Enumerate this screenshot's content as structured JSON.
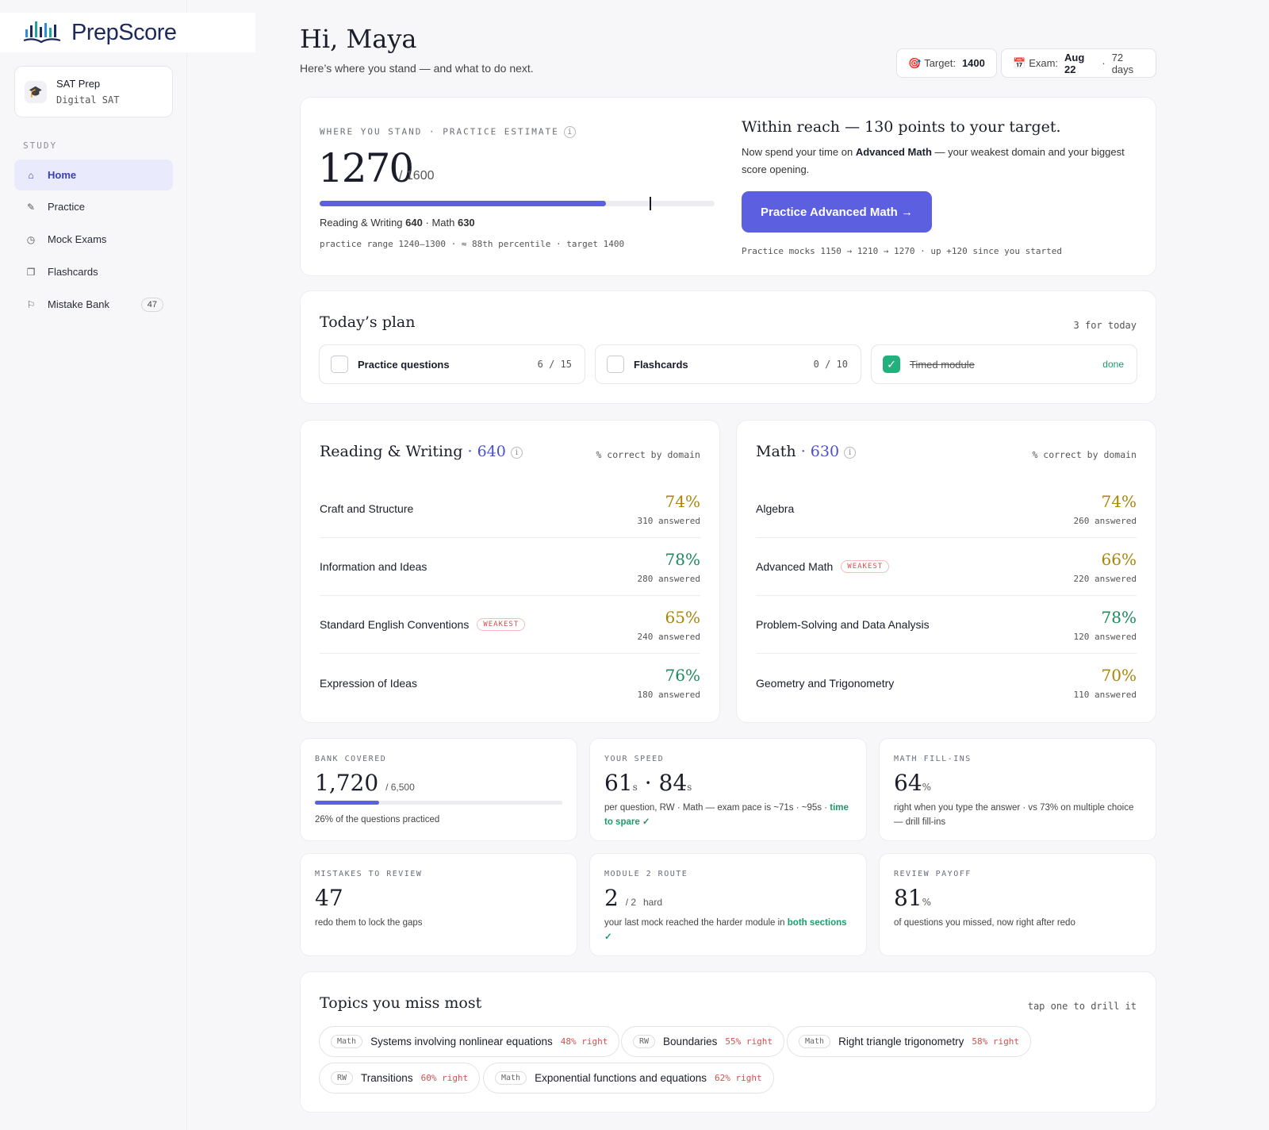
{
  "brand": {
    "name": "PrepScore"
  },
  "course": {
    "title": "SAT Prep",
    "subtitle": "Digital SAT"
  },
  "sidebar": {
    "section": "STUDY",
    "items": [
      {
        "label": "Home",
        "icon": "home-icon"
      },
      {
        "label": "Practice",
        "icon": "pencil-icon"
      },
      {
        "label": "Mock Exams",
        "icon": "stopwatch-icon"
      },
      {
        "label": "Flashcards",
        "icon": "cards-icon"
      },
      {
        "label": "Mistake Bank",
        "icon": "flag-icon",
        "badge": "47"
      }
    ]
  },
  "header": {
    "greeting": "Hi, Maya",
    "subtitle": "Here’s where you stand — and what to do next.",
    "target_label": "Target:",
    "target_value": "1400",
    "exam_label": "Exam:",
    "exam_date": "Aug 22",
    "exam_sep": "·",
    "exam_days": "72 days"
  },
  "score": {
    "label": "WHERE YOU STAND · PRACTICE ESTIMATE",
    "value": "1270",
    "max": "/ 1600",
    "progress": 0.725,
    "target_marker": 0.836,
    "rw_label": "Reading & Writing",
    "rw_value": "640",
    "math_label": "· Math",
    "math_value": "630",
    "range_text": "practice range 1240–1300 · ≈ 88th percentile · target 1400"
  },
  "reach": {
    "title": "Within reach — 130 points to your target.",
    "desc_pre": "Now spend your time on",
    "desc_bold": "Advanced Math",
    "desc_post": "— your weakest domain and your biggest score opening.",
    "button": "Practice Advanced Math →",
    "mocks": "Practice mocks 1150 → 1210 → 1270 · up +120 since you started"
  },
  "plan": {
    "title": "Today’s plan",
    "count": "3 for today",
    "tasks": [
      {
        "label": "Practice questions",
        "progress": "6 / 15",
        "done": false
      },
      {
        "label": "Flashcards",
        "progress": "0 / 10",
        "done": false
      },
      {
        "label": "Timed module",
        "progress": "done",
        "done": true,
        "check": "✓"
      }
    ]
  },
  "rw": {
    "title": "Reading & Writing",
    "score": "· 640",
    "caption": "% correct by domain",
    "domains": [
      {
        "name": "Craft and Structure",
        "pct": "74%",
        "answered": "310 answered",
        "color": "#a8860c"
      },
      {
        "name": "Information and Ideas",
        "pct": "78%",
        "answered": "280 answered",
        "color": "#1d8a5e"
      },
      {
        "name": "Standard English Conventions",
        "pct": "65%",
        "answered": "240 answered",
        "color": "#a8860c",
        "weak": "WEAKEST"
      },
      {
        "name": "Expression of Ideas",
        "pct": "76%",
        "answered": "180 answered",
        "color": "#1d8a5e"
      }
    ]
  },
  "math": {
    "title": "Math",
    "score": "· 630",
    "caption": "% correct by domain",
    "domains": [
      {
        "name": "Algebra",
        "pct": "74%",
        "answered": "260 answered",
        "color": "#a8860c"
      },
      {
        "name": "Advanced Math",
        "pct": "66%",
        "answered": "220 answered",
        "color": "#a8860c",
        "weak": "WEAKEST"
      },
      {
        "name": "Problem-Solving and Data Analysis",
        "pct": "78%",
        "answered": "120 answered",
        "color": "#1d8a5e"
      },
      {
        "name": "Geometry and Trigonometry",
        "pct": "70%",
        "answered": "110 answered",
        "color": "#a8860c"
      }
    ]
  },
  "stats": {
    "bank": {
      "label": "BANK COVERED",
      "value": "1,720",
      "of": "/ 6,500",
      "progress": 0.26,
      "desc": "26% of the questions practiced"
    },
    "speed": {
      "label": "YOUR SPEED",
      "v1": "61",
      "u1": "s",
      "sep": "·",
      "v2": "84",
      "u2": "s",
      "desc": "per question, RW · Math — exam pace is ~71s · ~95s ·",
      "ok": "time to spare ✓"
    },
    "fill": {
      "label": "MATH FILL-INS",
      "value": "64",
      "unit": "%",
      "desc": "right when you type the answer · vs 73% on multiple choice — drill fill-ins"
    },
    "mistakes": {
      "label": "MISTAKES TO REVIEW",
      "value": "47",
      "desc": "redo them to lock the gaps"
    },
    "route": {
      "label": "MODULE 2 ROUTE",
      "value": "2",
      "of": "/ 2",
      "unit": "hard",
      "desc": "your last mock reached the harder module in",
      "ok": "both sections ✓"
    },
    "payoff": {
      "label": "REVIEW PAYOFF",
      "value": "81",
      "unit": "%",
      "desc": "of questions you missed, now right after redo"
    }
  },
  "topics": {
    "title": "Topics you miss most",
    "hint": "tap one to drill it",
    "items": [
      {
        "tag": "Math",
        "name": "Systems involving nonlinear equations",
        "rate": "48% right"
      },
      {
        "tag": "RW",
        "name": "Boundaries",
        "rate": "55% right"
      },
      {
        "tag": "Math",
        "name": "Right triangle trigonometry",
        "rate": "58% right"
      },
      {
        "tag": "RW",
        "name": "Transitions",
        "rate": "60% right"
      },
      {
        "tag": "Math",
        "name": "Exponential functions and equations",
        "rate": "62% right"
      }
    ]
  },
  "colors": {
    "accent": "#5b5fe0",
    "good": "#1d8a5e",
    "mid": "#a8860c",
    "bad": "#d05050"
  }
}
